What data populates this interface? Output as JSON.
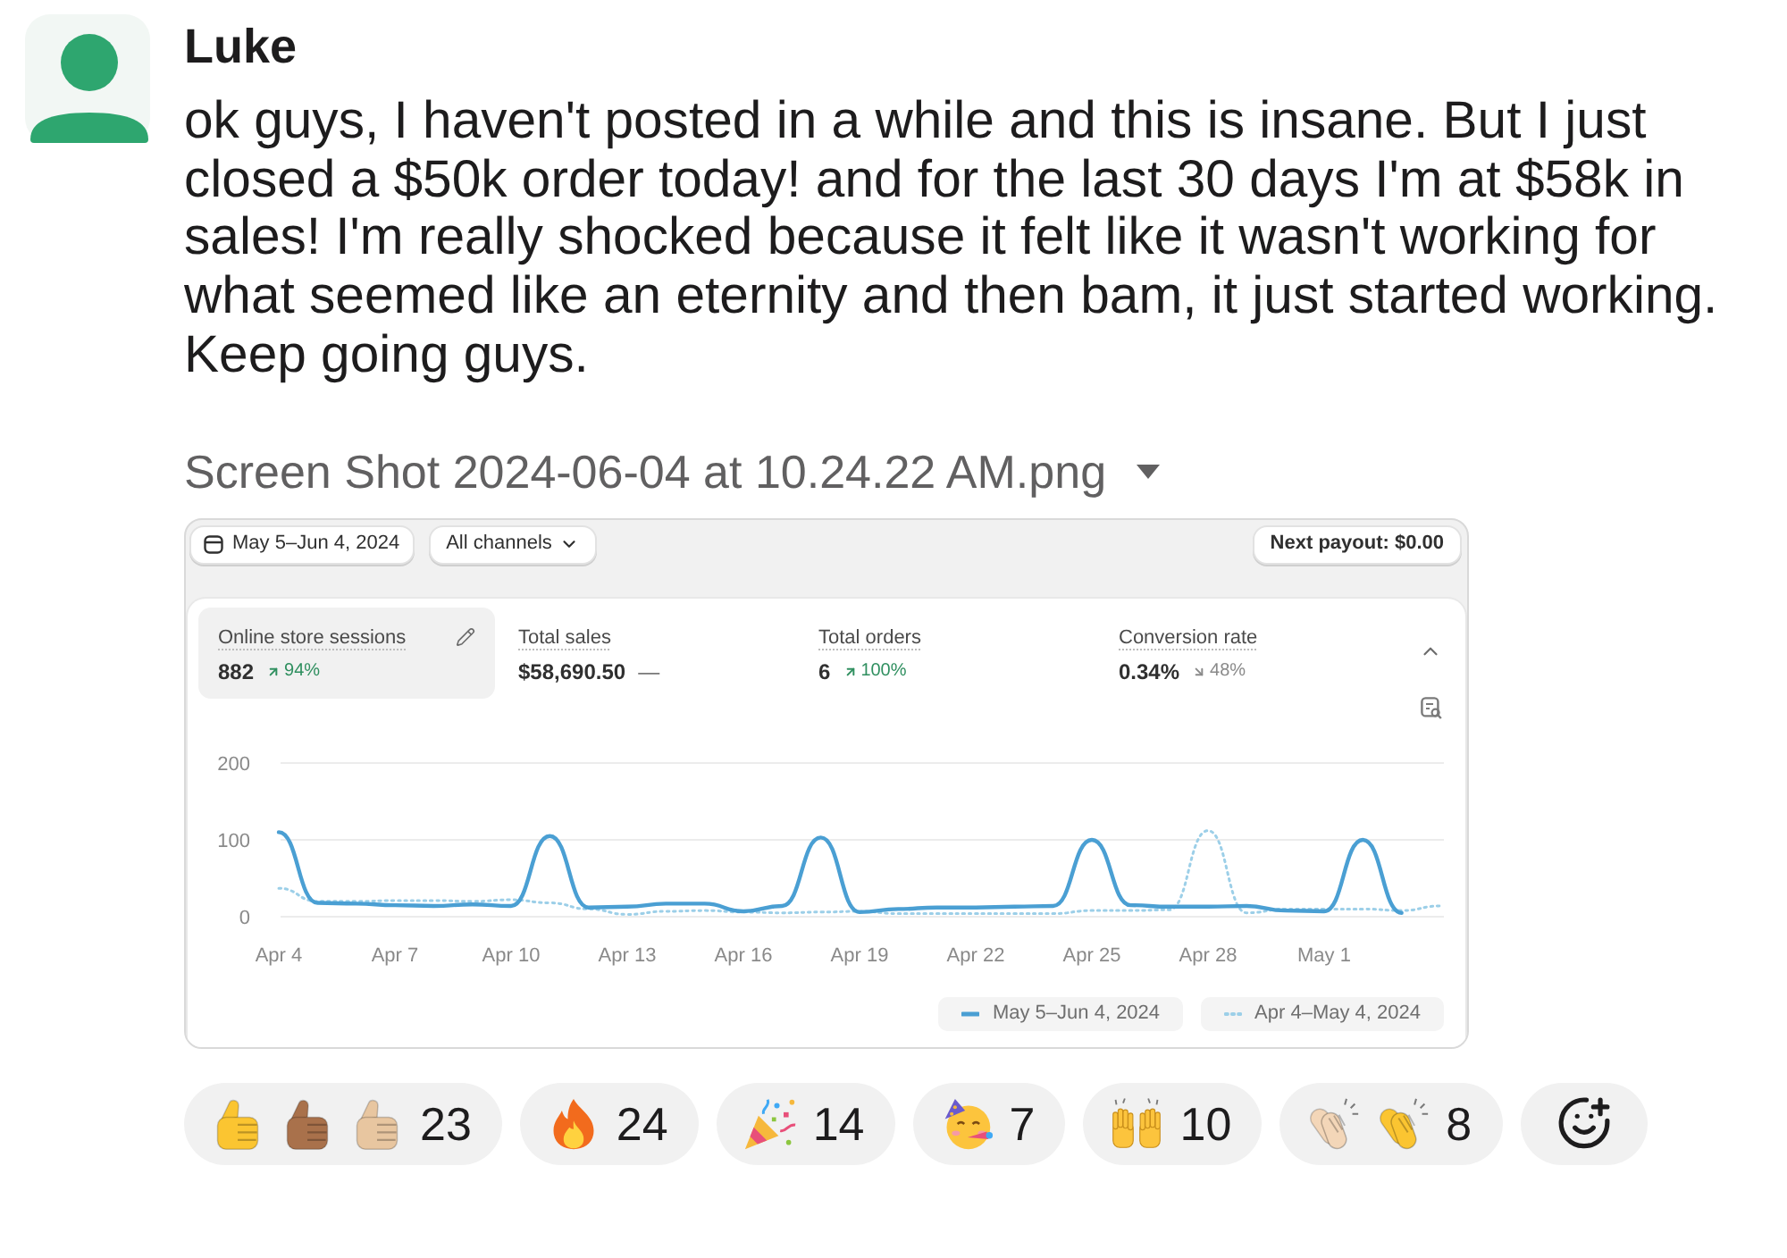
{
  "message": {
    "author": "Luke",
    "text": "ok guys, I haven't posted in a while and this is insane. But I just closed a $50k order today! and for the last 30 days I'm at $58k in sales! I'm really shocked because it felt like it wasn't working for what seemed like an eternity and then bam, it just started working. Keep going guys."
  },
  "attachment": {
    "filename": "Screen Shot 2024-06-04 at 10.24.22 AM.png"
  },
  "dashboard": {
    "date_range": "May 5–Jun 4, 2024",
    "channel_filter": "All channels",
    "payout": "Next payout: $0.00",
    "metrics": [
      {
        "kind": "up",
        "label": "Online store sessions",
        "value": "882",
        "change": "94%",
        "selected": true
      },
      {
        "kind": "flat",
        "label": "Total sales",
        "value": "$58,690.50",
        "change": "—",
        "selected": false
      },
      {
        "kind": "up",
        "label": "Total orders",
        "value": "6",
        "change": "100%",
        "selected": false
      },
      {
        "kind": "down",
        "label": "Conversion rate",
        "value": "0.34%",
        "change": "48%",
        "selected": false
      }
    ],
    "chart_data": {
      "type": "line",
      "categories": [
        "Apr 4",
        null,
        null,
        "Apr 7",
        null,
        null,
        "Apr 10",
        null,
        null,
        "Apr 13",
        null,
        null,
        "Apr 16",
        null,
        null,
        "Apr 19",
        null,
        null,
        "Apr 22",
        null,
        null,
        "Apr 25",
        null,
        null,
        "Apr 28",
        null,
        null,
        "May 1",
        null,
        null,
        null
      ],
      "ylim": [
        0,
        200
      ],
      "yticks": [
        0,
        100,
        200
      ],
      "legend": "bottom-right",
      "series": [
        {
          "name": "May 5–Jun 4, 2024",
          "color": "#4a9fd3",
          "line_style": "solid",
          "values": [
            110,
            18,
            17,
            15,
            14,
            16,
            14,
            105,
            12,
            13,
            17,
            17,
            7,
            14,
            103,
            6,
            10,
            12,
            12,
            13,
            14,
            100,
            15,
            13,
            13,
            14,
            8,
            7,
            100,
            5,
            null
          ]
        },
        {
          "name": "Apr 4–May 4, 2024",
          "color": "#9ccfe8",
          "line_style": "dotted",
          "values": [
            37,
            20,
            20,
            21,
            21,
            20,
            22,
            18,
            10,
            3,
            7,
            8,
            6,
            5,
            6,
            7,
            4,
            4,
            4,
            4,
            4,
            8,
            8,
            9,
            112,
            5,
            10,
            10,
            10,
            8,
            14
          ]
        }
      ]
    }
  },
  "reactions": [
    {
      "emojis": [
        {
          "kind": "thumbs-up",
          "color": "#fbc531"
        },
        {
          "kind": "thumbs-up",
          "color": "#a9714b"
        },
        {
          "kind": "thumbs-up",
          "color": "#e8c6a0"
        }
      ],
      "count": "23"
    },
    {
      "emojis": [
        {
          "kind": "fire"
        }
      ],
      "count": "24"
    },
    {
      "emojis": [
        {
          "kind": "party-popper"
        }
      ],
      "count": "14"
    },
    {
      "emojis": [
        {
          "kind": "partying-face"
        }
      ],
      "count": "7"
    },
    {
      "emojis": [
        {
          "kind": "raising-hands"
        }
      ],
      "count": "10"
    },
    {
      "emojis": [
        {
          "kind": "clapping-hands",
          "color": "#f3d6b8"
        },
        {
          "kind": "clapping-hands",
          "color": "#fbc531"
        }
      ],
      "count": "8"
    }
  ]
}
